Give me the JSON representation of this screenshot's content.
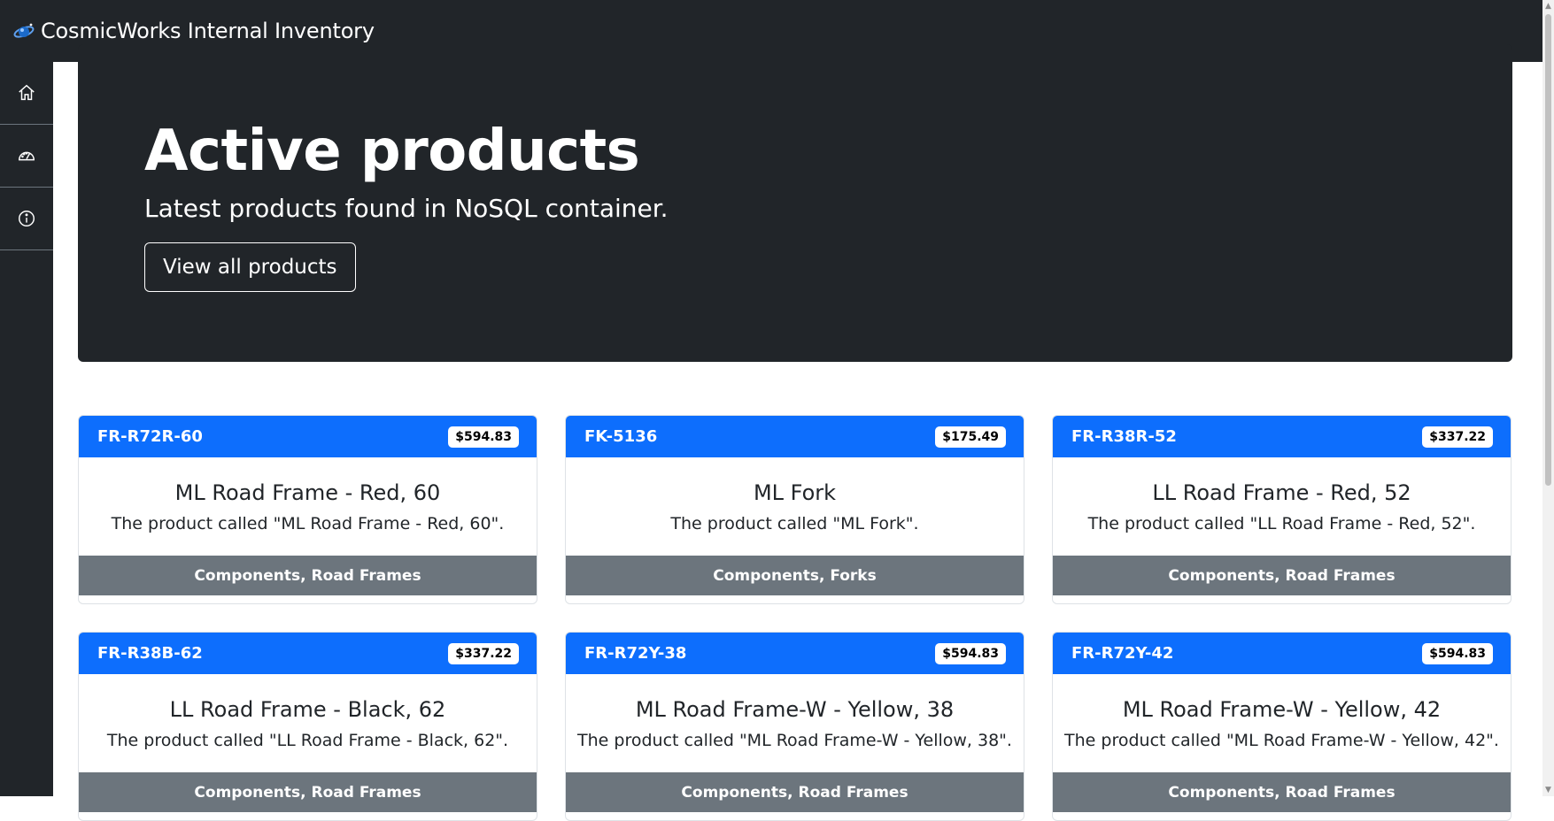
{
  "app": {
    "title": "CosmicWorks Internal Inventory"
  },
  "sidebar": {
    "items": [
      {
        "name": "home",
        "icon": "home-icon"
      },
      {
        "name": "dashboard",
        "icon": "speedometer-icon"
      },
      {
        "name": "about",
        "icon": "info-icon"
      }
    ]
  },
  "hero": {
    "title": "Active products",
    "subtitle": "Latest products found in NoSQL container.",
    "button_label": "View all products"
  },
  "products": [
    {
      "sku": "FR-R72R-60",
      "price": "$594.83",
      "name": "ML Road Frame - Red, 60",
      "description": "The product called \"ML Road Frame - Red, 60\".",
      "category": "Components, Road Frames"
    },
    {
      "sku": "FK-5136",
      "price": "$175.49",
      "name": "ML Fork",
      "description": "The product called \"ML Fork\".",
      "category": "Components, Forks"
    },
    {
      "sku": "FR-R38R-52",
      "price": "$337.22",
      "name": "LL Road Frame - Red, 52",
      "description": "The product called \"LL Road Frame - Red, 52\".",
      "category": "Components, Road Frames"
    },
    {
      "sku": "FR-R38B-62",
      "price": "$337.22",
      "name": "LL Road Frame - Black, 62",
      "description": "The product called \"LL Road Frame - Black, 62\".",
      "category": "Components, Road Frames"
    },
    {
      "sku": "FR-R72Y-38",
      "price": "$594.83",
      "name": "ML Road Frame-W - Yellow, 38",
      "description": "The product called \"ML Road Frame-W - Yellow, 38\".",
      "category": "Components, Road Frames"
    },
    {
      "sku": "FR-R72Y-42",
      "price": "$594.83",
      "name": "ML Road Frame-W - Yellow, 42",
      "description": "The product called \"ML Road Frame-W - Yellow, 42\".",
      "category": "Components, Road Frames"
    }
  ],
  "colors": {
    "dark": "#212529",
    "primary": "#0d6efd",
    "secondary": "#6c757d"
  }
}
